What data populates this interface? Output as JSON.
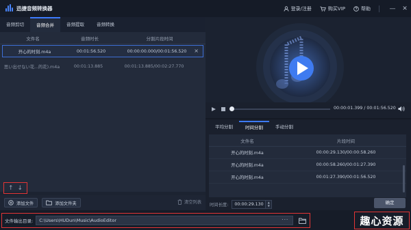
{
  "titlebar": {
    "title": "迅捷音频转换器",
    "login": "登录/注册",
    "buy_vip": "购买VIP",
    "help": "帮助"
  },
  "tabs": [
    "音频剪切",
    "音频合并",
    "音频提取",
    "音频转换"
  ],
  "file_list": {
    "headers": [
      "文件名",
      "音频时长",
      "分割片段时间"
    ],
    "rows": [
      {
        "name": "开心的时刻.m4a",
        "duration": "00:01:56.520",
        "segment": "00:00:00.000/00:01:56.520"
      },
      {
        "name": "思い出せない花...的花).m4a",
        "duration": "00:01:13.885",
        "segment": "00:01:13.885/00:02:27.770"
      }
    ]
  },
  "buttons": {
    "add_file": "添加文件",
    "add_folder": "添加文件夹",
    "clear_list": "清空列表"
  },
  "player": {
    "time": "00:00:01.399  /  00:01:56.520",
    "progress": 0.012
  },
  "split_tabs": [
    "平均分割",
    "时间分割",
    "手动分割"
  ],
  "segments": {
    "headers": [
      "文件名",
      "片段时间"
    ],
    "rows": [
      {
        "name": "开心的时刻.m4a",
        "time": "00:00:29.130/00:00:58.260"
      },
      {
        "name": "开心的时刻.m4a",
        "time": "00:00:58.260/00:01:27.390"
      },
      {
        "name": "开心的时刻.m4a",
        "time": "00:01:27.390/00:01:56.520"
      }
    ]
  },
  "duration_control": {
    "label": "时间长度:",
    "value": "00:00:29.130",
    "confirm": "确定"
  },
  "output": {
    "label": "文件输出目录:",
    "path": "C:\\Users\\HUDun\\Music\\AudioEditor",
    "more": "···"
  },
  "watermark": "趣心资源",
  "colors": {
    "accent": "#3d7bff",
    "highlight_box": "#e53535",
    "background": "#1c2331"
  }
}
